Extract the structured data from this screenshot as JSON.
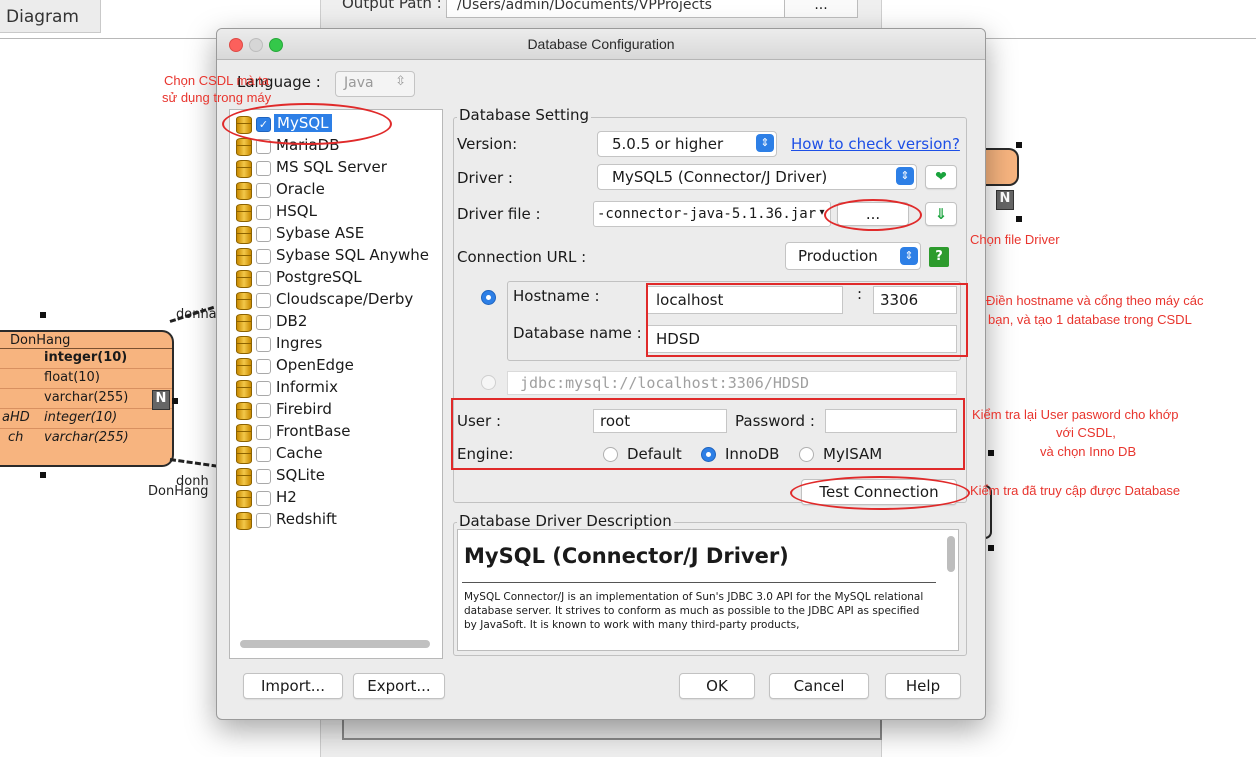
{
  "background": {
    "diagram_tab": "Diagram",
    "output_path_label": "Output Path :",
    "output_path_value": "/Users/admin/Documents/VPProjects",
    "output_path_button": "...",
    "entity": {
      "name": "DonHang",
      "rows": [
        {
          "name": "",
          "type": "integer(10)"
        },
        {
          "name": "",
          "type": "float(10)"
        },
        {
          "name": "",
          "type": "varchar(255)"
        },
        {
          "name": "aHD",
          "type": "integer(10)"
        },
        {
          "name": "ch",
          "type": "varchar(255)"
        }
      ],
      "n_badge": "N"
    },
    "rel_label_1": "donha",
    "rel_label_2": "donh",
    "rel_label_3": "DonHang",
    "right_entity_badge": "N"
  },
  "dialog": {
    "title": "Database Configuration",
    "language_label": "Language :",
    "language_value": "Java",
    "databases": [
      {
        "name": "MySQL",
        "checked": true
      },
      {
        "name": "MariaDB",
        "checked": false
      },
      {
        "name": "MS SQL Server",
        "checked": false
      },
      {
        "name": "Oracle",
        "checked": false
      },
      {
        "name": "HSQL",
        "checked": false
      },
      {
        "name": "Sybase ASE",
        "checked": false
      },
      {
        "name": "Sybase SQL Anywhe",
        "checked": false
      },
      {
        "name": "PostgreSQL",
        "checked": false
      },
      {
        "name": "Cloudscape/Derby",
        "checked": false
      },
      {
        "name": "DB2",
        "checked": false
      },
      {
        "name": "Ingres",
        "checked": false
      },
      {
        "name": "OpenEdge",
        "checked": false
      },
      {
        "name": "Informix",
        "checked": false
      },
      {
        "name": "Firebird",
        "checked": false
      },
      {
        "name": "FrontBase",
        "checked": false
      },
      {
        "name": "Cache",
        "checked": false
      },
      {
        "name": "SQLite",
        "checked": false
      },
      {
        "name": "H2",
        "checked": false
      },
      {
        "name": "Redshift",
        "checked": false
      }
    ],
    "setting": {
      "group_label": "Database Setting",
      "version_label": "Version:",
      "version_value": "5.0.5 or higher",
      "version_link": "How to check version?",
      "driver_label": "Driver :",
      "driver_value": "MySQL5 (Connector/J Driver)",
      "driver_file_label": "Driver file :",
      "driver_file_value": "-connector-java-5.1.36.jar",
      "driver_file_browse": "...",
      "connection_url_label": "Connection URL :",
      "connection_url_mode": "Production",
      "help_glyph": "?",
      "hostname_label": "Hostname :",
      "hostname_value": "localhost",
      "port_sep": ":",
      "port_value": "3306",
      "dbname_label": "Database name :",
      "dbname_value": "HDSD",
      "jdbc_url": "jdbc:mysql://localhost:3306/HDSD",
      "user_label": "User :",
      "user_value": "root",
      "password_label": "Password :",
      "password_value": "",
      "engine_label": "Engine:",
      "engine_options": [
        "Default",
        "InnoDB",
        "MyISAM"
      ],
      "engine_selected": "InnoDB",
      "test_button": "Test Connection"
    },
    "description": {
      "group_label": "Database Driver Description",
      "title": "MySQL (Connector/J Driver)",
      "body": "MySQL Connector/J is an implementation of Sun's JDBC 3.0 API for the MySQL relational database server. It strives to conform as much as possible to the JDBC API as specified by JavaSoft. It is known to work with many third-party products,"
    },
    "buttons": {
      "import": "Import...",
      "export": "Export...",
      "ok": "OK",
      "cancel": "Cancel",
      "help": "Help"
    }
  },
  "annotations": {
    "choose_db_line1": "Chọn CSDL mà ta",
    "choose_db_line2": "sử dụng trong máy",
    "choose_driver": "Chọn file Driver",
    "host_line1": "Điền hostname và cổng theo máy các",
    "host_line2": "bạn,  và tạo 1 database trong CSDL",
    "user_line1": "Kiểm tra lại User pasword cho khớp",
    "user_line2": "với CSDL,",
    "user_line3": "và chọn Inno DB",
    "test_note": "Kiểm tra đã truy cập được Database"
  },
  "colors": {
    "accent": "#2d7fe6",
    "annotation_red": "#e8352e",
    "entity_orange": "#f7b47f"
  }
}
